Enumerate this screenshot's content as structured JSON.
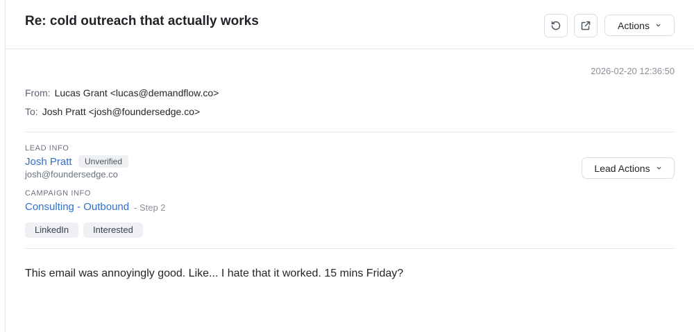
{
  "header": {
    "subject": "Re: cold outreach that actually works",
    "actions_label": "Actions",
    "history_icon": "history-icon",
    "open_icon": "external-link-icon"
  },
  "message": {
    "timestamp": "2026-02-20 12:36:50",
    "from_label": "From:",
    "from_value": "Lucas Grant <lucas@demandflow.co>",
    "to_label": "To:",
    "to_value": "Josh Pratt <josh@foundersedge.co>",
    "body": "This email was annoyingly good. Like... I hate that it worked. 15 mins Friday?"
  },
  "lead": {
    "section_label": "LEAD INFO",
    "name": "Josh Pratt",
    "status_badge": "Unverified",
    "email": "josh@foundersedge.co",
    "actions_label": "Lead Actions"
  },
  "campaign": {
    "section_label": "CAMPAIGN INFO",
    "name": "Consulting - Outbound",
    "step": "- Step 2"
  },
  "tags": [
    "LinkedIn",
    "Interested"
  ],
  "colors": {
    "link": "#2f6fd0",
    "muted": "#6b7280",
    "border": "#e5e7eb",
    "tag_bg": "#eef0f3"
  }
}
